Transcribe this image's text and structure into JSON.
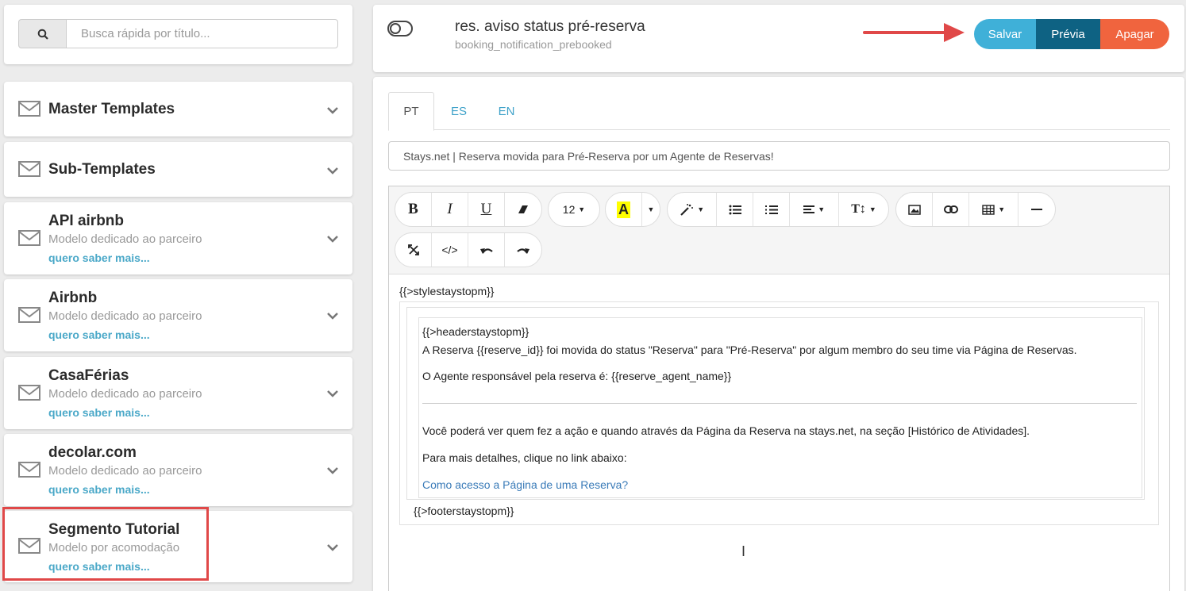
{
  "search": {
    "placeholder": "Busca rápida por título..."
  },
  "templates": [
    {
      "title": "Master Templates"
    },
    {
      "title": "Sub-Templates"
    },
    {
      "title": "API airbnb",
      "subtitle": "Modelo dedicado ao parceiro",
      "more": "quero saber mais..."
    },
    {
      "title": "Airbnb",
      "subtitle": "Modelo dedicado ao parceiro",
      "more": "quero saber mais..."
    },
    {
      "title": "CasaFérias",
      "subtitle": "Modelo dedicado ao parceiro",
      "more": "quero saber mais..."
    },
    {
      "title": "decolar.com",
      "subtitle": "Modelo dedicado ao parceiro",
      "more": "quero saber mais..."
    },
    {
      "title": "Segmento Tutorial",
      "subtitle": "Modelo por acomodação",
      "more": "quero saber mais..."
    }
  ],
  "header": {
    "title": "res. aviso status pré-reserva",
    "key": "booking_notification_prebooked",
    "salvar": "Salvar",
    "previa": "Prévia",
    "apagar": "Apagar"
  },
  "tabs": [
    "PT",
    "ES",
    "EN"
  ],
  "subject": "Stays.net | Reserva movida para Pré-Reserva por um Agente de Reservas!",
  "toolbar": {
    "font_size": "12"
  },
  "body": {
    "style_tag": "{{>stylestaystopm}}",
    "header_tag": "{{>headerstaystopm}}",
    "line1": "A Reserva {{reserve_id}} foi movida do status \"Reserva\" para \"Pré-Reserva\" por algum membro do seu time via Página de Reservas.",
    "line2": "O Agente responsável pela reserva é: {{reserve_agent_name}}",
    "line3": "Você poderá ver quem fez a ação e quando através da Página da Reserva na stays.net, na seção [Histórico de Atividades].",
    "line4": "Para mais detalhes, clique no link abaixo:",
    "link": "Como acesso a Página de uma Reserva?",
    "footer_tag": "{{>footerstaystopm}}"
  },
  "colors": {
    "salvar": "#3fb0d8",
    "previa": "#0e6283",
    "apagar": "#f0643e",
    "link": "#4aa8c8",
    "highlight": "#e04848"
  }
}
